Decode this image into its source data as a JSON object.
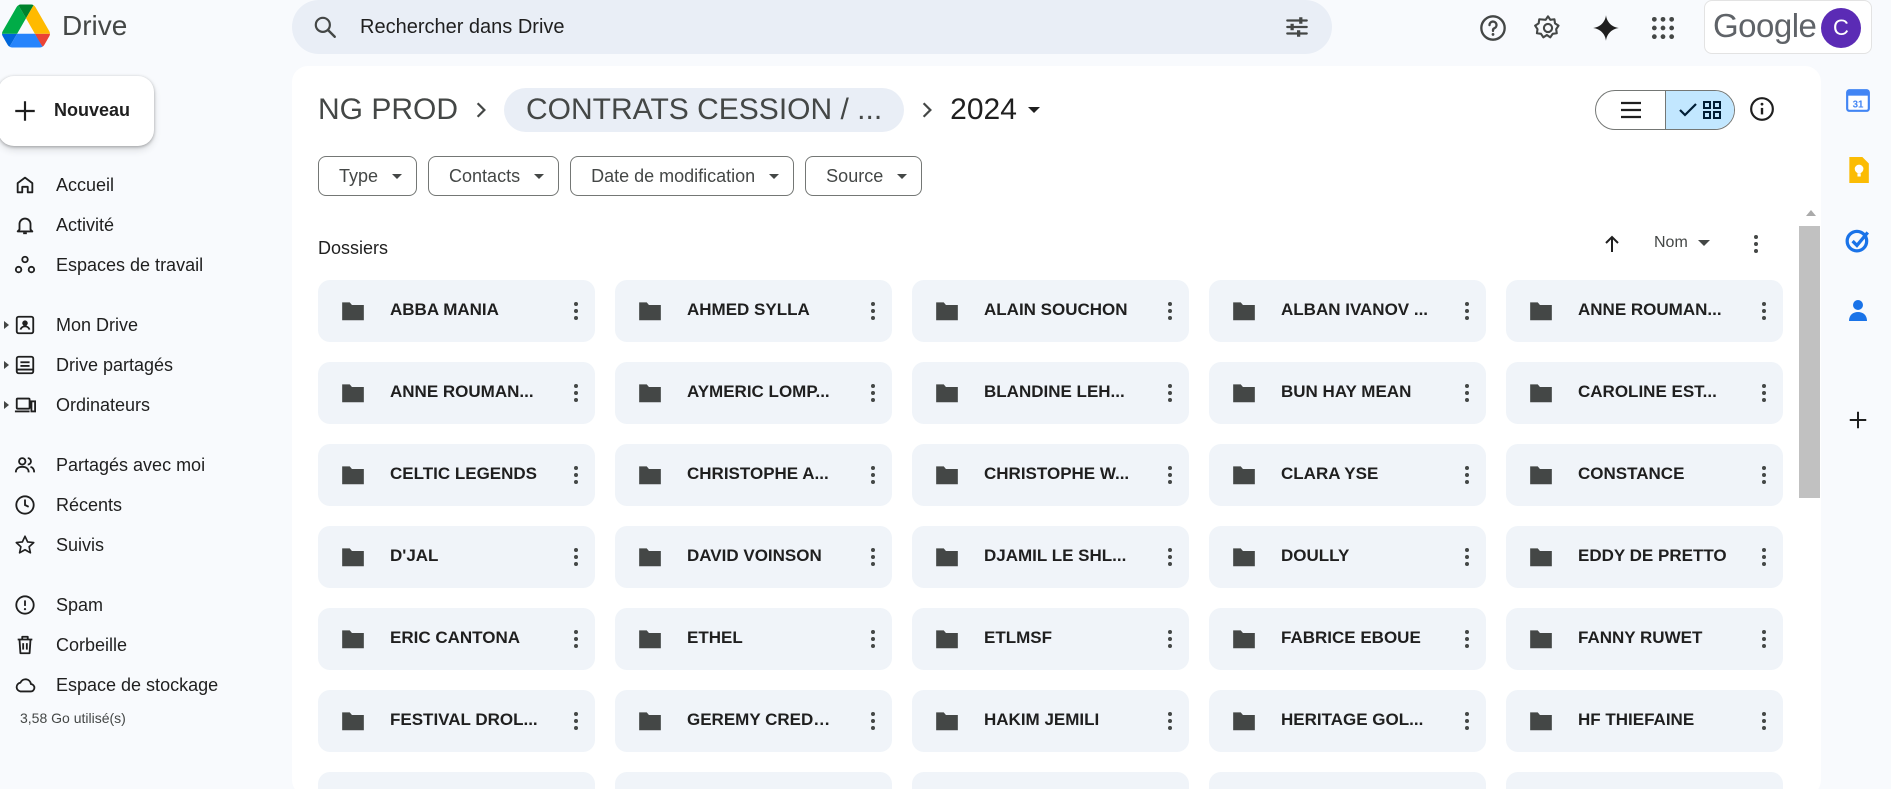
{
  "app": {
    "name": "Drive"
  },
  "search": {
    "placeholder": "Rechercher dans Drive"
  },
  "account": {
    "brand": "Google",
    "avatar_letter": "C",
    "avatar_color": "#5b2bb5"
  },
  "sidebar": {
    "new_label": "Nouveau",
    "items": [
      {
        "label": "Accueil",
        "icon": "home-icon"
      },
      {
        "label": "Activité",
        "icon": "bell-icon"
      },
      {
        "label": "Espaces de travail",
        "icon": "workspaces-icon"
      },
      {
        "label": "Mon Drive",
        "icon": "my-drive-icon"
      },
      {
        "label": "Drive partagés",
        "icon": "shared-drives-icon"
      },
      {
        "label": "Ordinateurs",
        "icon": "computers-icon"
      },
      {
        "label": "Partagés avec moi",
        "icon": "shared-with-me-icon"
      },
      {
        "label": "Récents",
        "icon": "clock-icon"
      },
      {
        "label": "Suivis",
        "icon": "star-icon"
      },
      {
        "label": "Spam",
        "icon": "spam-icon"
      },
      {
        "label": "Corbeille",
        "icon": "trash-icon"
      },
      {
        "label": "Espace de stockage",
        "icon": "cloud-icon"
      }
    ],
    "storage_used": "3,58 Go utilisé(s)"
  },
  "breadcrumb": {
    "root": "NG PROD",
    "middle": "CONTRATS CESSION / ...",
    "current": "2024"
  },
  "filters": [
    "Type",
    "Contacts",
    "Date de modification",
    "Source"
  ],
  "section": {
    "title": "Dossiers",
    "sort_label": "Nom"
  },
  "folders": [
    "ABBA MANIA",
    "AHMED SYLLA",
    "ALAIN SOUCHON",
    "ALBAN IVANOV ...",
    "ANNE ROUMAN...",
    "ANNE ROUMAN...",
    "AYMERIC LOMP...",
    "BLANDINE LEH...",
    "BUN HAY MEAN",
    "CAROLINE EST...",
    "CELTIC LEGENDS",
    "CHRISTOPHE A...",
    "CHRISTOPHE W...",
    "CLARA YSE",
    "CONSTANCE",
    "D'JAL",
    "DAVID VOINSON",
    "DJAMIL LE SHL...",
    "DOULLY",
    "EDDY DE PRETTO",
    "ERIC CANTONA",
    "ETHEL",
    "ETLMSF",
    "FABRICE EBOUE",
    "FANNY RUWET",
    "FESTIVAL DROL...",
    "GEREMY CREDE...",
    "HAKIM JEMILI",
    "HERITAGE GOL...",
    "HF THIEFAINE"
  ],
  "colors": {
    "accent": "#c2e7ff",
    "folder_bg": "#f0f4f9",
    "search_bg": "#e9eef6"
  }
}
